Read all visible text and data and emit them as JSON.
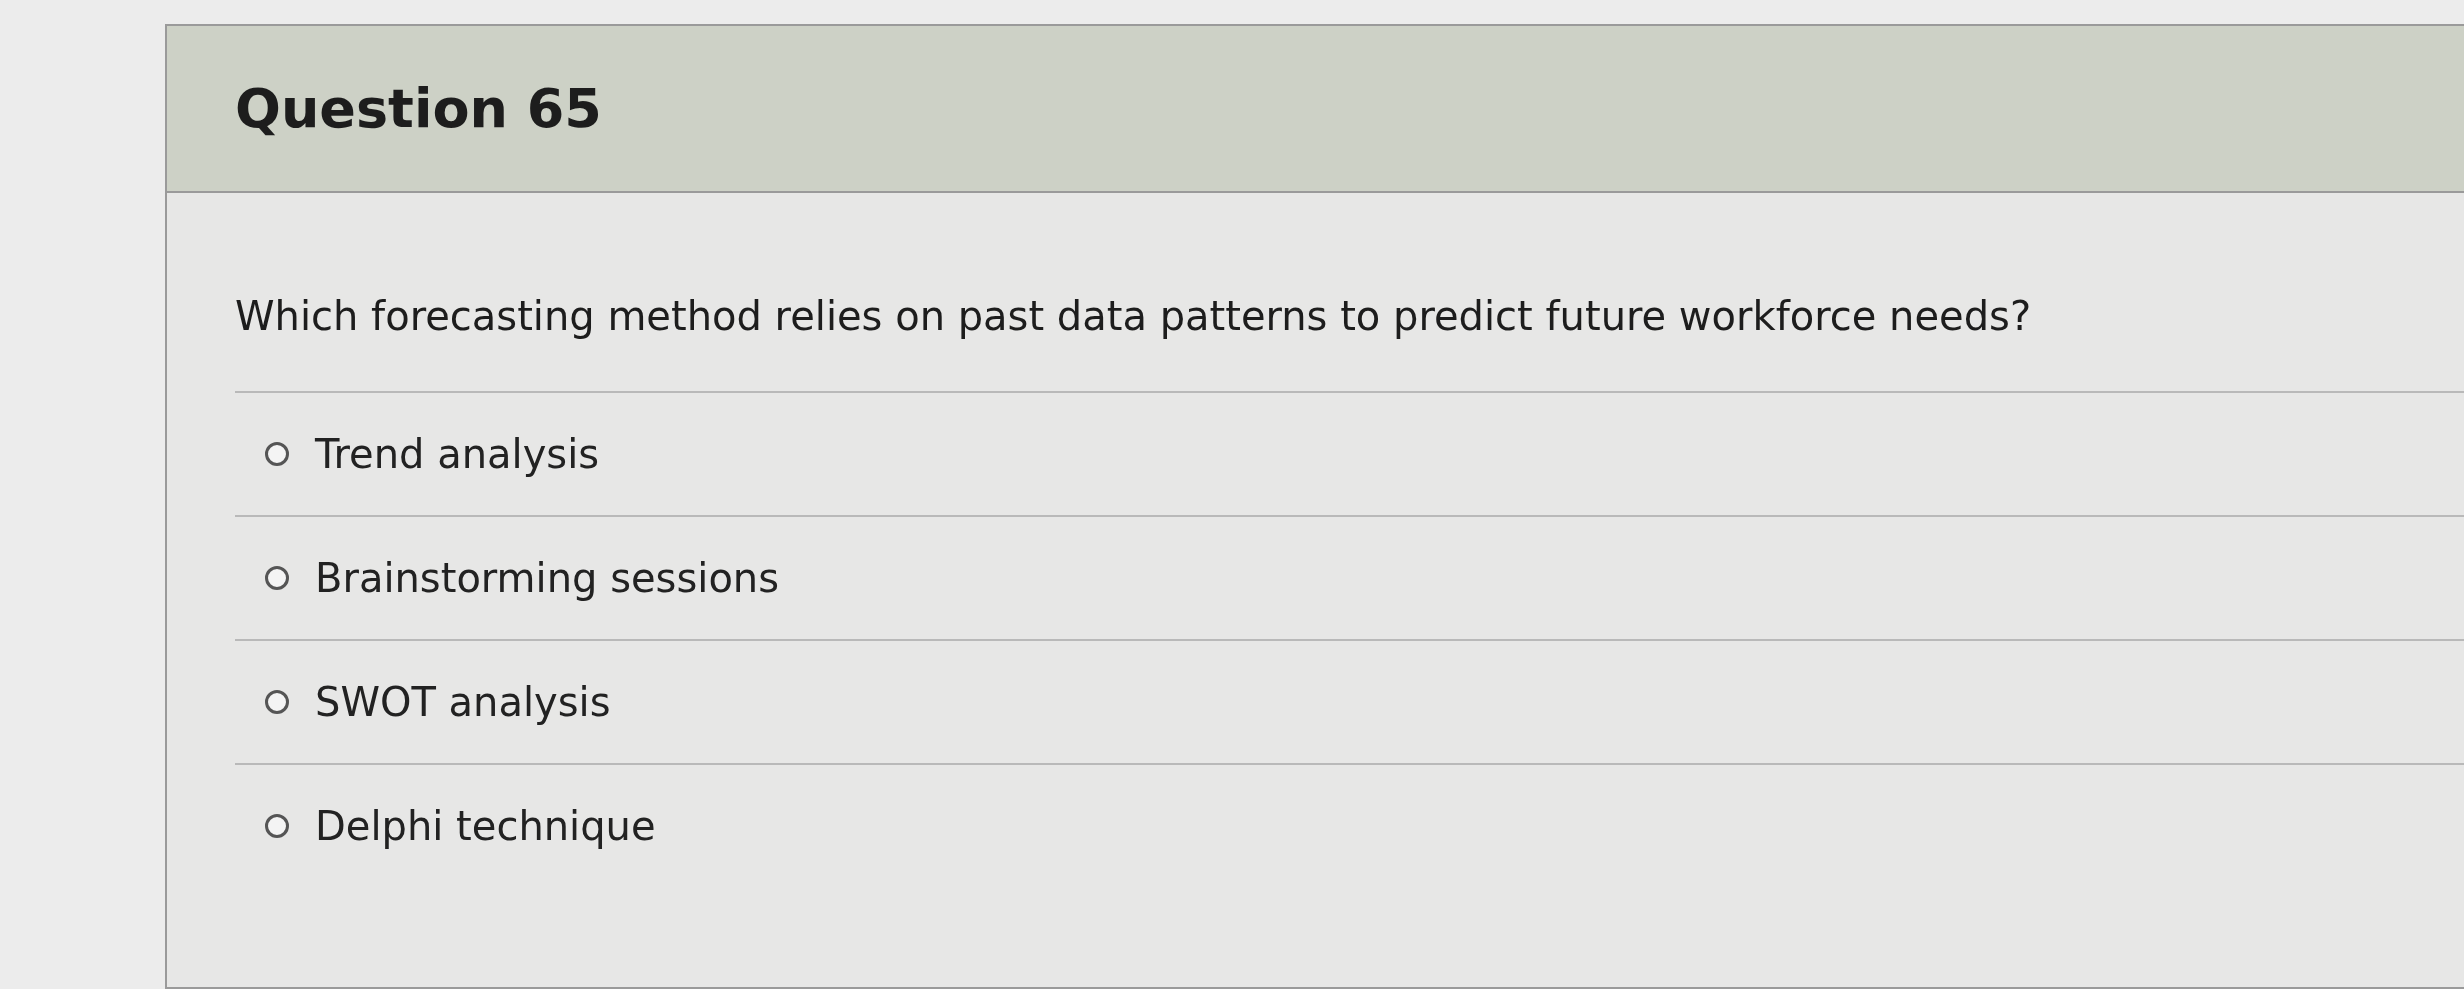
{
  "question": {
    "title": "Question 65",
    "text": "Which forecasting method relies on past data patterns to predict future workforce needs?",
    "options": [
      {
        "label": "Trend analysis",
        "selected": false
      },
      {
        "label": "Brainstorming sessions",
        "selected": false
      },
      {
        "label": "SWOT analysis",
        "selected": false
      },
      {
        "label": "Delphi technique",
        "selected": false
      }
    ]
  }
}
